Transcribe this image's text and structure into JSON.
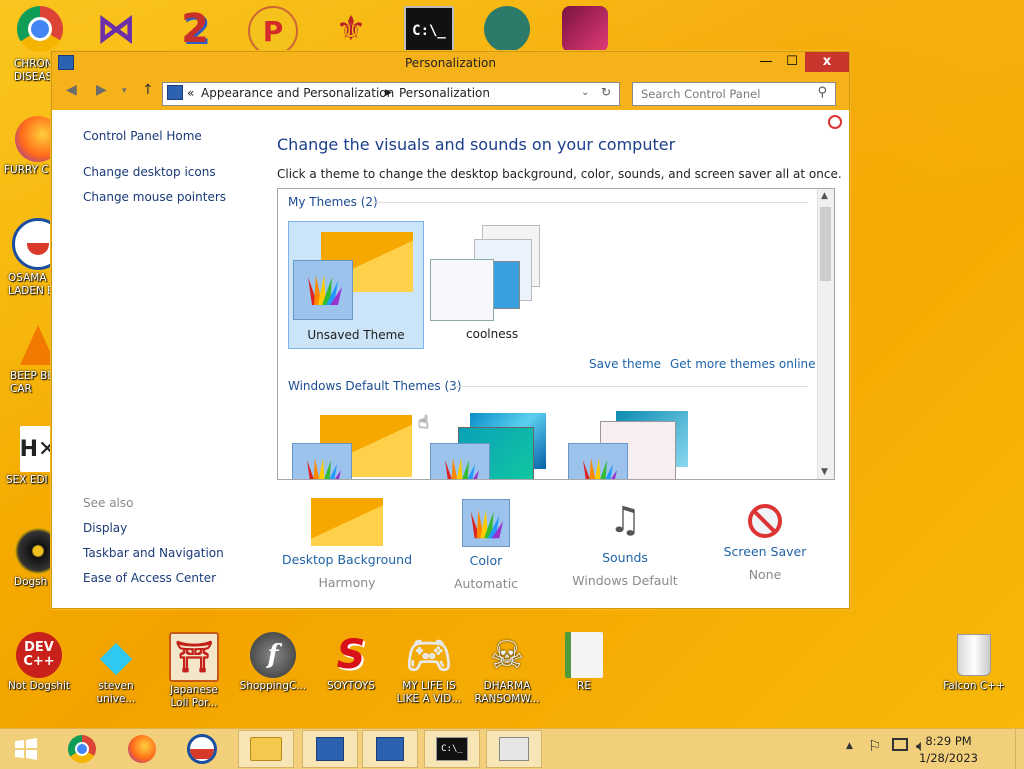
{
  "desktop_icons_left": [
    {
      "label": "CHRON\nDISEAS"
    },
    {
      "label": "FURRY C"
    },
    {
      "label": "OSAMA\nLADEN B"
    },
    {
      "label": "BEEP BE\nCAR"
    },
    {
      "label": "SEX EDI"
    },
    {
      "label": "Dogsh"
    }
  ],
  "desktop_icons_bottom": [
    {
      "label": "Not Dogshit"
    },
    {
      "label": "steven\nunive..."
    },
    {
      "label": "Japanese\nLoli Por..."
    },
    {
      "label": "ShoppingC..."
    },
    {
      "label": "SOYTOYS"
    },
    {
      "label": "MY LIFE IS\nLIKE A VID..."
    },
    {
      "label": "DHARMA\nRANSOMW..."
    },
    {
      "label": "RE"
    },
    {
      "label": "Falcon C++"
    }
  ],
  "window": {
    "title": "Personalization",
    "buttons": {
      "minimize": "—",
      "maximize": "☐",
      "close": "x"
    }
  },
  "address": {
    "prefix": "«",
    "crumbs": [
      "Appearance and Personalization",
      "Personalization"
    ],
    "search_placeholder": "Search Control Panel"
  },
  "sidebar": {
    "home": "Control Panel Home",
    "links": [
      "Change desktop icons",
      "Change mouse pointers"
    ],
    "see_also_title": "See also",
    "see_also": [
      "Display",
      "Taskbar and Navigation",
      "Ease of Access Center"
    ]
  },
  "main": {
    "heading": "Change the visuals and sounds on your computer",
    "subtitle": "Click a theme to change the desktop background, color, sounds, and screen saver all at once.",
    "my_themes_title": "My Themes (2)",
    "my_themes": [
      "Unsaved Theme",
      "coolness"
    ],
    "save_theme": "Save theme",
    "get_more": "Get more themes online",
    "default_themes_title": "Windows Default Themes (3)"
  },
  "bottom": [
    {
      "label": "Desktop Background",
      "sub": "Harmony"
    },
    {
      "label": "Color",
      "sub": "Automatic"
    },
    {
      "label": "Sounds",
      "sub": "Windows Default"
    },
    {
      "label": "Screen Saver",
      "sub": "None"
    }
  ],
  "taskbar": {
    "time": "8:29 PM",
    "date": "1/28/2023"
  },
  "colors": {
    "accent": "#f6b21a",
    "link": "#1f63a8",
    "heading": "#1b3f8a",
    "close": "#c8362d"
  }
}
